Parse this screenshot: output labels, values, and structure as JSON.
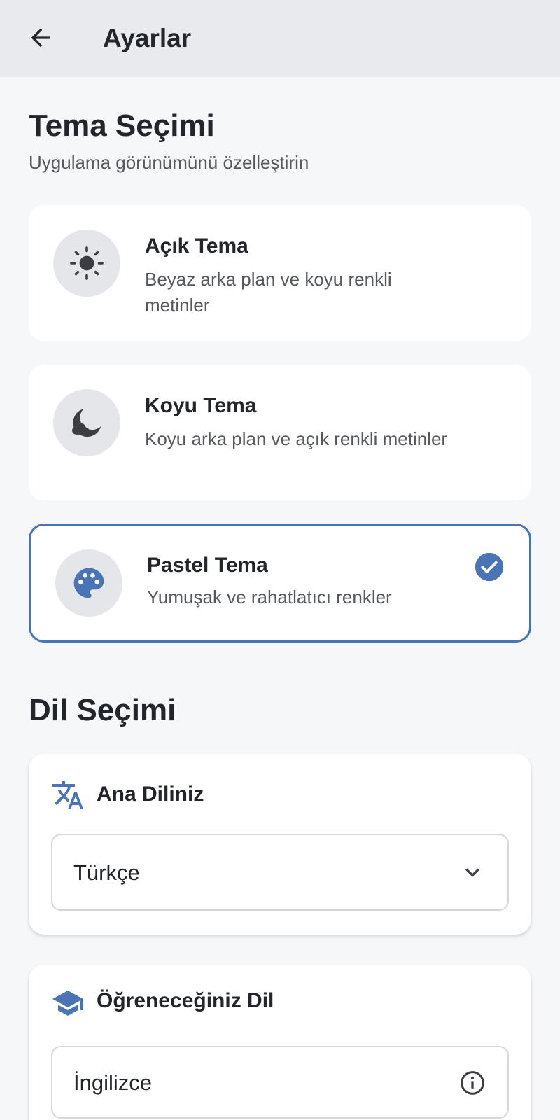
{
  "header": {
    "title": "Ayarlar",
    "back_icon": "arrow-left-icon"
  },
  "theme_section": {
    "title": "Tema Seçimi",
    "subtitle": "Uygulama görünümünü özelleştirin",
    "options": [
      {
        "name": "Açık Tema",
        "description": "Beyaz arka plan ve koyu renkli metinler",
        "icon": "sun-icon",
        "selected": false
      },
      {
        "name": "Koyu Tema",
        "description": "Koyu arka plan ve açık renkli metinler",
        "icon": "moon-icon",
        "selected": false
      },
      {
        "name": "Pastel Tema",
        "description": "Yumuşak ve rahatlatıcı renkler",
        "icon": "palette-icon",
        "selected": true
      }
    ]
  },
  "language_section": {
    "title": "Dil Seçimi",
    "native": {
      "label": "Ana Diliniz",
      "icon": "translate-icon",
      "value": "Türkçe",
      "trailing_icon": "chevron-down-icon"
    },
    "target": {
      "label": "Öğreneceğiniz Dil",
      "icon": "graduation-cap-icon",
      "value": "İngilizce",
      "trailing_icon": "info-icon"
    }
  },
  "colors": {
    "accent": "#4a74b4",
    "background": "#f6f7f9",
    "appbar": "#e8eaee",
    "card": "#ffffff"
  }
}
